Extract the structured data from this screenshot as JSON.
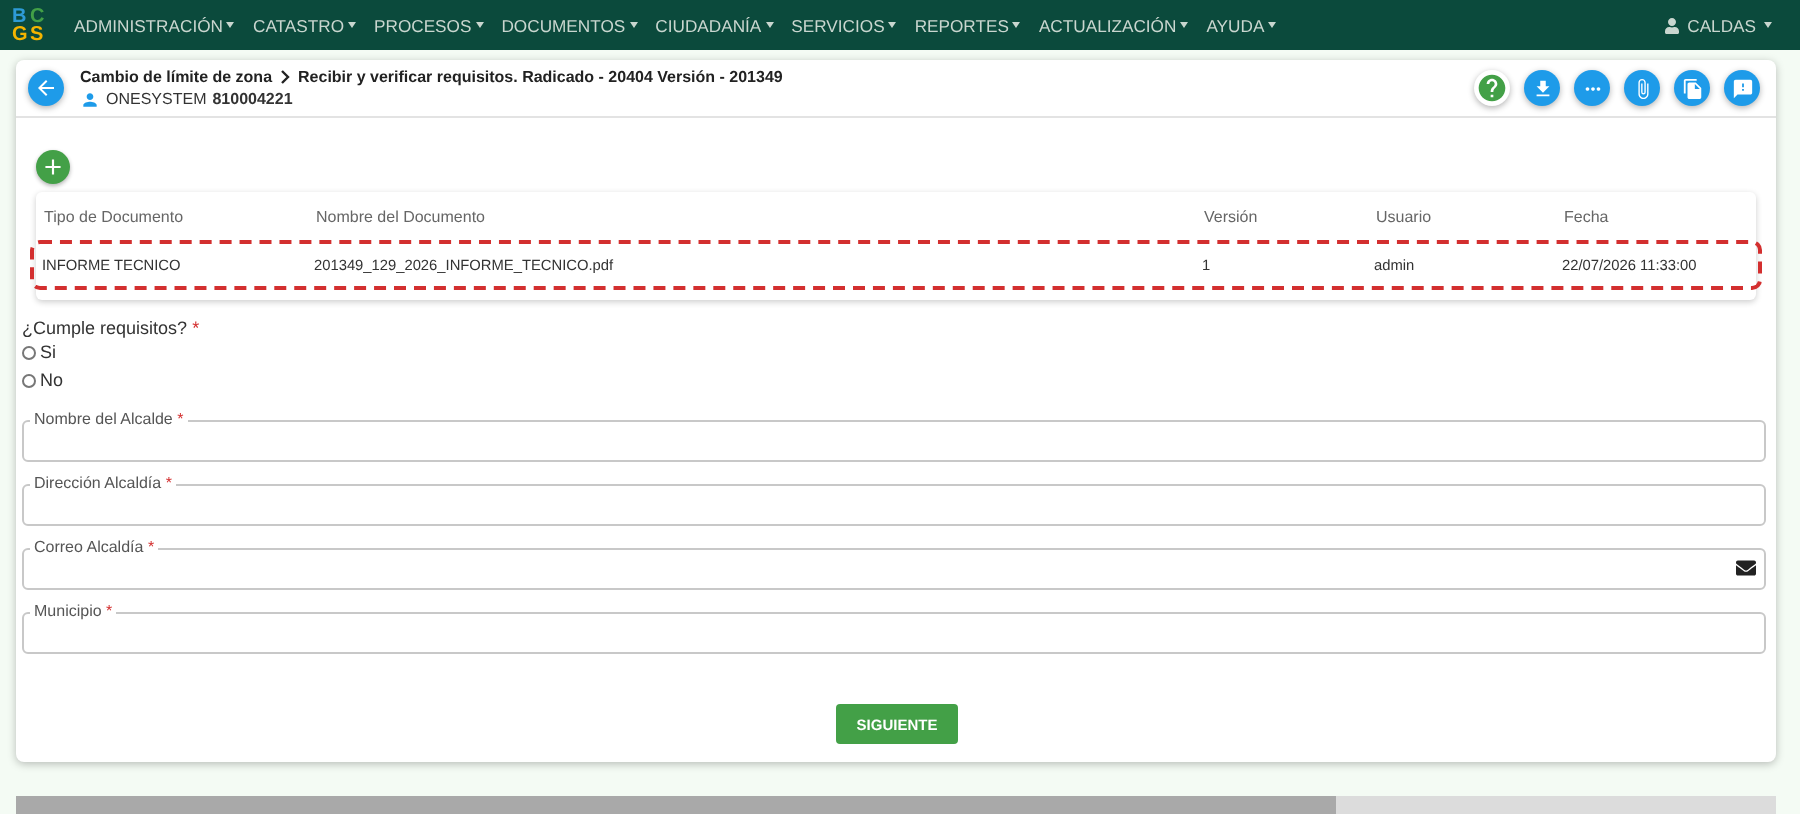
{
  "logo": {
    "letters": [
      {
        "char": "B",
        "color": "#2e9bd6"
      },
      {
        "char": "C",
        "color": "#43a047"
      },
      {
        "char": "G",
        "color": "#f4b400"
      },
      {
        "char": "S",
        "color": "#f4b400"
      }
    ]
  },
  "nav": {
    "menus": [
      "ADMINISTRACIÓN",
      "CATASTRO",
      "PROCESOS",
      "DOCUMENTOS",
      "CIUDADANÍA",
      "SERVICIOS",
      "REPORTES",
      "ACTUALIZACIÓN",
      "AYUDA"
    ],
    "user": "CALDAS"
  },
  "header": {
    "breadcrumb": [
      "Cambio de límite de zona",
      "Recibir y verificar requisitos. Radicado - 20404 Versión - 201349"
    ],
    "owner": "ONESYSTEM",
    "owner_id": "810004221"
  },
  "toolbar": [
    {
      "kind": "help"
    },
    {
      "kind": "download"
    },
    {
      "kind": "more"
    },
    {
      "kind": "attach"
    },
    {
      "kind": "copy"
    },
    {
      "kind": "comment"
    }
  ],
  "table": {
    "columns": [
      "Tipo de Documento",
      "Nombre del Documento",
      "Versión",
      "Usuario",
      "Fecha"
    ],
    "rows": [
      {
        "selected": true,
        "cells": [
          "INFORME TECNICO",
          "201349_129_2026_INFORME_TECNICO.pdf",
          "1",
          "admin",
          "22/07/2026 11:33:00"
        ]
      }
    ]
  },
  "question": {
    "label": "¿Cumple requisitos?",
    "required_mark": "*",
    "options": [
      {
        "label": "Si",
        "selected": false
      },
      {
        "label": "No",
        "selected": false
      }
    ]
  },
  "fields": [
    {
      "label": "Nombre del Alcalde",
      "required_mark": "*",
      "kind": "text"
    },
    {
      "label": "Dirección Alcaldía",
      "required_mark": "*",
      "kind": "text"
    },
    {
      "label": "Correo Alcaldía",
      "required_mark": "*",
      "kind": "email"
    },
    {
      "label": "Municipio",
      "required_mark": "*",
      "kind": "text"
    }
  ],
  "submit": "SIGUIENTE"
}
